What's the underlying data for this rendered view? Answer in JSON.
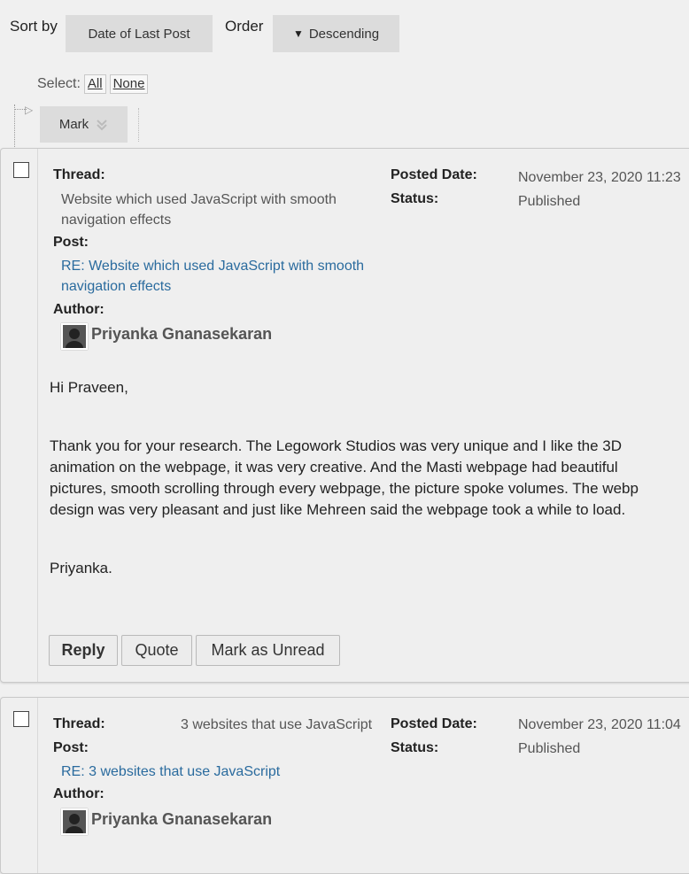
{
  "toolbar": {
    "sort_label": "Sort by",
    "sort_value": "Date of Last Post",
    "order_label": "Order",
    "order_value": "Descending",
    "select_label": "Select:",
    "select_all": "All",
    "select_none": "None",
    "mark_label": "Mark"
  },
  "posts": [
    {
      "thread_label": "Thread:",
      "thread_value": "Website which used JavaScript with smooth navigation effects",
      "post_label": "Post:",
      "post_link": "RE: Website which used JavaScript with smooth navigation effects",
      "author_label": "Author:",
      "author_name": "Priyanka Gnanasekaran",
      "posted_label": "Posted Date:",
      "posted_value": "November 23, 2020 11:23",
      "status_label": "Status:",
      "status_value": "Published",
      "body": [
        "Hi Praveen,",
        "Thank you for your research. The Legowork Studios was very unique and I like the 3D",
        "animation on the webpage, it was very creative. And the Masti webpage had beautiful",
        "pictures, smooth scrolling through every webpage, the picture spoke volumes. The webp",
        "design was very pleasant and just like Mehreen said the webpage took a while to load.",
        "Priyanka."
      ],
      "reply_label": "Reply",
      "quote_label": "Quote",
      "unread_label": "Mark as Unread"
    },
    {
      "thread_label": "Thread:",
      "thread_value": "3 websites that use JavaScript",
      "post_label": "Post:",
      "post_link": "RE: 3 websites that use JavaScript",
      "author_label": "Author:",
      "author_name": "Priyanka Gnanasekaran",
      "posted_label": "Posted Date:",
      "posted_value": "November 23, 2020 11:04",
      "status_label": "Status:",
      "status_value": "Published"
    }
  ]
}
